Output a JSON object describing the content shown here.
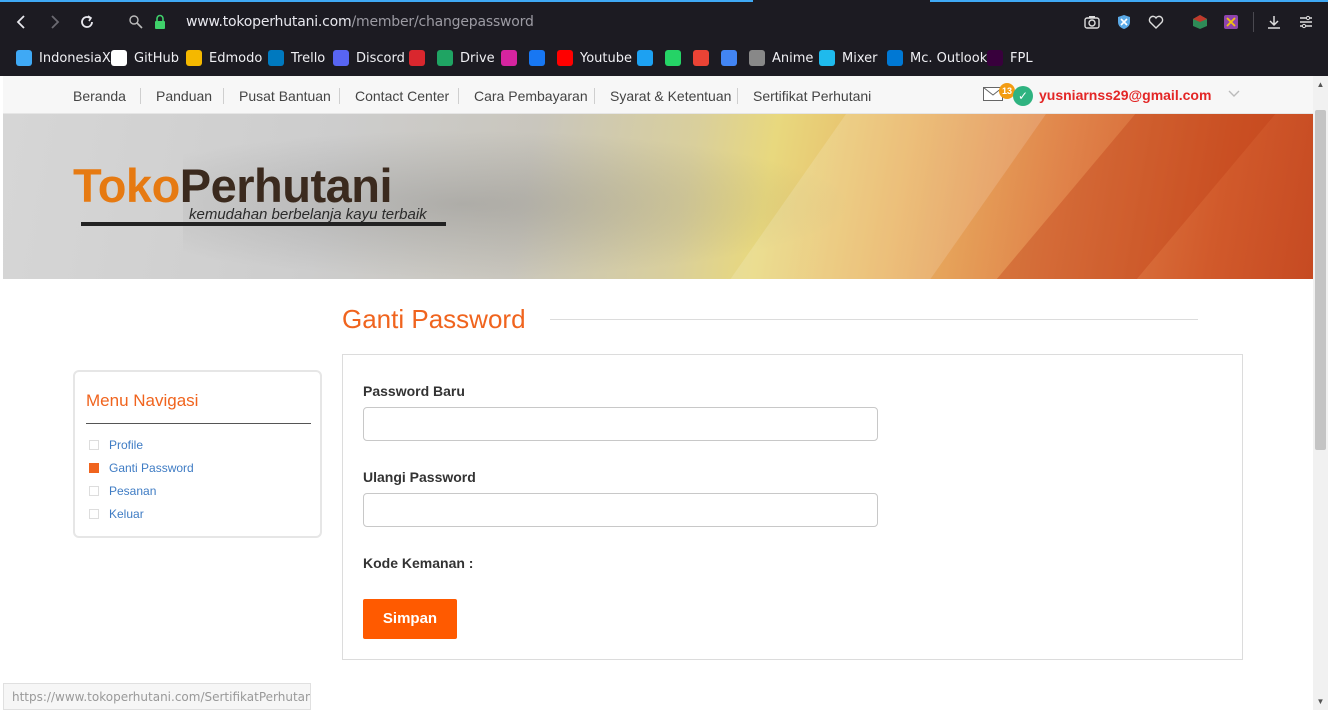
{
  "browser": {
    "url_domain": "www.tokoperhutani.com",
    "url_path": "/member/changepassword",
    "bookmarks": [
      {
        "label": "IndonesiaX",
        "icon": "indonesiax-icon",
        "color": "#3fa9f5"
      },
      {
        "label": "GitHub",
        "icon": "github-icon",
        "color": "#ffffff"
      },
      {
        "label": "Edmodo",
        "icon": "edmodo-icon",
        "color": "#f5b800"
      },
      {
        "label": "Trello",
        "icon": "trello-icon",
        "color": "#0079bf"
      },
      {
        "label": "Discord",
        "icon": "discord-icon",
        "color": "#5865f2"
      },
      {
        "label": "",
        "icon": "mega-icon",
        "color": "#d9272e"
      },
      {
        "label": "Drive",
        "icon": "drive-icon",
        "color": "#1fa463"
      },
      {
        "label": "",
        "icon": "instagram-icon",
        "color": "#d6249f"
      },
      {
        "label": "",
        "icon": "facebook-icon",
        "color": "#1877f2"
      },
      {
        "label": "Youtube",
        "icon": "youtube-icon",
        "color": "#ff0000"
      },
      {
        "label": "",
        "icon": "twitter-icon",
        "color": "#1da1f2"
      },
      {
        "label": "",
        "icon": "whatsapp-icon",
        "color": "#25d366"
      },
      {
        "label": "",
        "icon": "gmail-icon",
        "color": "#ea4335"
      },
      {
        "label": "",
        "icon": "google-icon",
        "color": "#4285f4"
      },
      {
        "label": "Anime",
        "icon": "anime-icon",
        "color": "#888888"
      },
      {
        "label": "Mixer",
        "icon": "mixer-icon",
        "color": "#1fbaed"
      },
      {
        "label": "Mc. Outlook",
        "icon": "outlook-icon",
        "color": "#0078d4"
      },
      {
        "label": "FPL",
        "icon": "fpl-icon",
        "color": "#38003c"
      }
    ],
    "status_url": "https://www.tokoperhutani.com/SertifikatPerhutani"
  },
  "topnav": {
    "items": [
      "Beranda",
      "Panduan",
      "Pusat Bantuan",
      "Contact Center",
      "Cara Pembayaran",
      "Syarat & Ketentuan",
      "Sertifikat Perhutani"
    ],
    "mail_count": "13",
    "user_email": "yusniarnss29@gmail.com"
  },
  "banner": {
    "logo_part1": "Toko",
    "logo_part2": "Perhutani",
    "tagline": "kemudahan berbelanja kayu terbaik"
  },
  "main": {
    "title": "Ganti Password"
  },
  "sidebar": {
    "title": "Menu Navigasi",
    "items": [
      {
        "label": "Profile",
        "active": false
      },
      {
        "label": "Ganti Password",
        "active": true
      },
      {
        "label": "Pesanan",
        "active": false
      },
      {
        "label": "Keluar",
        "active": false
      }
    ]
  },
  "form": {
    "new_password_label": "Password Baru",
    "new_password_value": "",
    "repeat_password_label": "Ulangi Password",
    "repeat_password_value": "",
    "security_code_label": "Kode Kemanan :",
    "save_label": "Simpan"
  },
  "colors": {
    "accent": "#f0641e",
    "button": "#ff5a00",
    "link": "#3f7cc4",
    "email": "#e32626"
  }
}
